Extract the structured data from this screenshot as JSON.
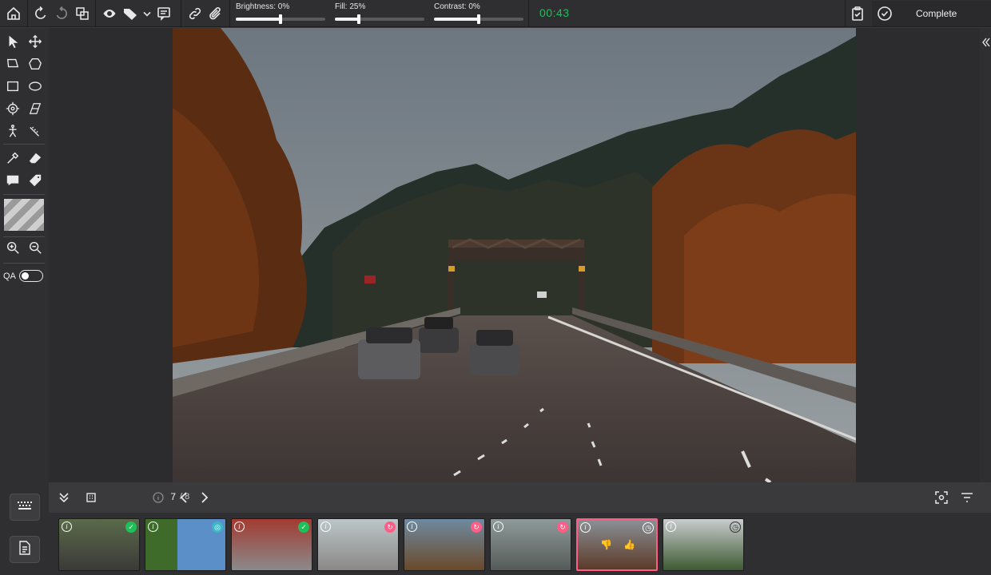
{
  "toolbar": {
    "brightness_label": "Brightness: 0%",
    "brightness_value": 0.5,
    "fill_label": "Fill: 25%",
    "fill_value": 0.25,
    "contrast_label": "Contrast: 0%",
    "contrast_value": 0.5,
    "timer": "00:43",
    "complete_label": "Complete"
  },
  "left_tools": {
    "qa_label": "QA",
    "qa_enabled": false
  },
  "navigation": {
    "current_page": "7",
    "total_pages": "/ 8"
  },
  "filmstrip": {
    "thumbnails": [
      {
        "index": 1,
        "status": "approved",
        "status_icon": "check-icon",
        "status_color": "#1fbf5a"
      },
      {
        "index": 2,
        "status": "in-review",
        "status_icon": "review-icon",
        "status_color": "#3fb6c6"
      },
      {
        "index": 3,
        "status": "approved",
        "status_icon": "check-icon",
        "status_color": "#1fbf5a"
      },
      {
        "index": 4,
        "status": "rejected",
        "status_icon": "redo-icon",
        "status_color": "#ff5d86"
      },
      {
        "index": 5,
        "status": "rejected",
        "status_icon": "redo-icon",
        "status_color": "#ff5d86"
      },
      {
        "index": 6,
        "status": "rejected",
        "status_icon": "redo-icon",
        "status_color": "#ff5d86"
      },
      {
        "index": 7,
        "status": "pending",
        "status_icon": "clock-icon",
        "status_color": "#cfcfcf",
        "selected": true
      },
      {
        "index": 8,
        "status": "pending",
        "status_icon": "clock-icon",
        "status_color": "#cfcfcf"
      }
    ]
  },
  "colors": {
    "accent": "#1fbf5a",
    "selection": "#ff5d86",
    "panel": "#2f2f31"
  }
}
